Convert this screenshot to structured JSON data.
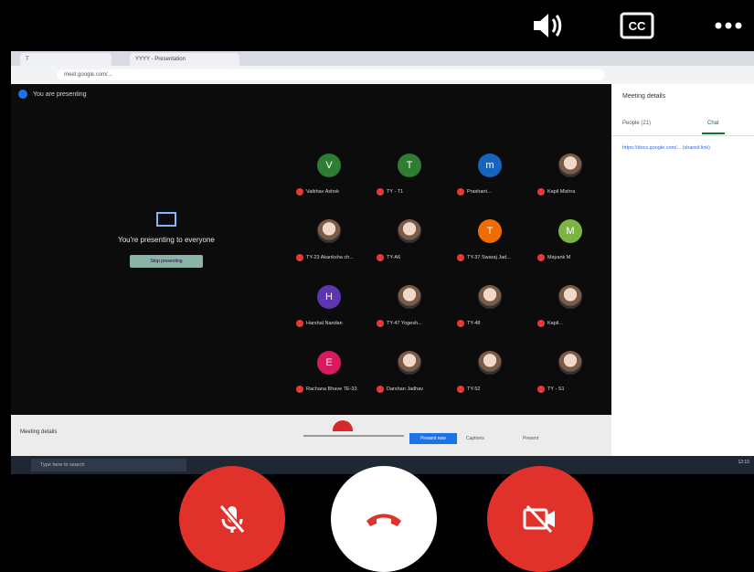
{
  "top_icons": [
    "speaker-icon",
    "closed-captions-icon",
    "more-options-icon"
  ],
  "cc_label": "CC",
  "browser": {
    "tabs": [
      "T",
      "YYYY - Presentation"
    ],
    "address": "meet.google.com/..."
  },
  "meet": {
    "presenting_chip": "You are presenting",
    "center_message": "You're presenting to everyone",
    "stop_button": "Stop presenting",
    "participants": [
      {
        "initial": "V",
        "color": "#2e7d32",
        "name": "Vaibhav Ashok"
      },
      {
        "initial": "T",
        "color": "#2e7d32",
        "name": "TY - T1"
      },
      {
        "initial": "m",
        "color": "#1565c0",
        "name": "Prashant..."
      },
      {
        "initial": "",
        "color": "photo",
        "name": "Kapil Mishra"
      },
      {
        "initial": "",
        "color": "photo",
        "name": "TY-23 Akanksha ch..."
      },
      {
        "initial": "",
        "color": "photo",
        "name": "TY-A6"
      },
      {
        "initial": "T",
        "color": "#ef6c00",
        "name": "TY-37 Swaraj Jad..."
      },
      {
        "initial": "M",
        "color": "#7cb342",
        "name": "Mayank M"
      },
      {
        "initial": "H",
        "color": "#5e35b1",
        "name": "Harshal Nandan"
      },
      {
        "initial": "",
        "color": "photo",
        "name": "TY-47 Yogesh..."
      },
      {
        "initial": "",
        "color": "photo",
        "name": "TY-48"
      },
      {
        "initial": "",
        "color": "photo",
        "name": "Kapil..."
      },
      {
        "initial": "E",
        "color": "#d81b60",
        "name": "Rachana Bhave TE-33"
      },
      {
        "initial": "",
        "color": "photo",
        "name": "Darshan Jadhav"
      },
      {
        "initial": "",
        "color": "photo",
        "name": "TY-52"
      },
      {
        "initial": "",
        "color": "photo",
        "name": "TY - S1"
      }
    ],
    "side_panel": {
      "title": "Meeting details",
      "people_tab": "People (21)",
      "chat_tab": "Chat",
      "chat_text": "https://docs.google.com/... (shared link)"
    },
    "controls": {
      "meeting_details": "Meeting details",
      "present_now": "Present now",
      "captions": "Captions",
      "present": "Present"
    },
    "taskbar_search": "Type here to search",
    "taskbar_clock": "12:15"
  },
  "call_buttons": [
    "mic-off-icon",
    "end-call-icon",
    "camera-off-icon"
  ]
}
